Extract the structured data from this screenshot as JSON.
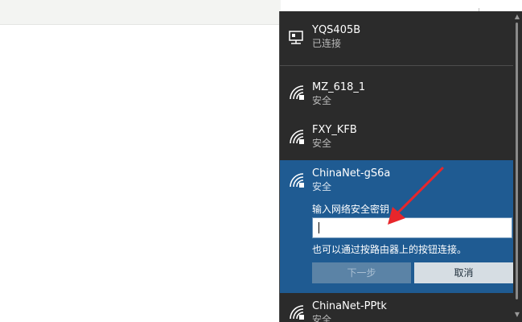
{
  "networks": [
    {
      "name": "YQS405B",
      "status": "已连接",
      "icon": "ethernet-icon"
    },
    {
      "name": "MZ_618_1",
      "status": "安全",
      "icon": "wifi-secure-icon"
    },
    {
      "name": "FXY_KFB",
      "status": "安全",
      "icon": "wifi-secure-icon"
    },
    {
      "name": "ChinaNet-gS6a",
      "status": "安全",
      "icon": "wifi-secure-icon"
    },
    {
      "name": "ChinaNet-PPtk",
      "status": "安全",
      "icon": "wifi-secure-icon"
    }
  ],
  "connect_form": {
    "label": "输入网络安全密钥",
    "password_value": "",
    "hint": "也可以通过按路由器上的按钮连接。",
    "next_label": "下一步",
    "cancel_label": "取消"
  },
  "colors": {
    "flyout_bg": "#2b2b2b",
    "selected_bg": "#1f5b92",
    "annotation_arrow": "#e8262b"
  }
}
